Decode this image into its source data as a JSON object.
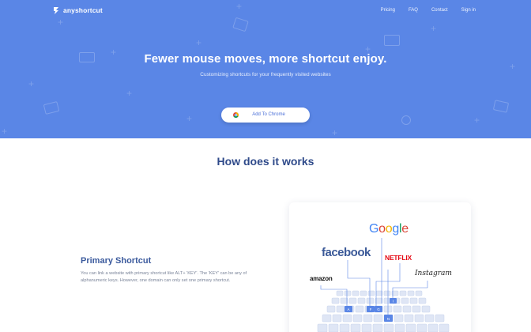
{
  "brand": {
    "name": "anyshortcut",
    "icon": "logo-icon"
  },
  "nav": {
    "items": [
      "Pricing",
      "FAQ",
      "Contact",
      "Sign in"
    ]
  },
  "hero": {
    "title": "Fewer mouse moves, more shortcut enjoy.",
    "subtitle": "Customizing shortcuts for your frequently visited websites",
    "cta_label": "Add To Chrome",
    "cta_icon": "chrome-icon"
  },
  "how": {
    "title": "How does it works",
    "primary": {
      "title": "Primary Shortcut",
      "description": "You can link a website with primary shortcut like ALT+ 'KEY'. The 'KEY' can be any of alphanumeric keys. However, one domain can only set one primary shortcut."
    },
    "illustration": {
      "brands": [
        "Google",
        "facebook",
        "NETFLIX",
        "amazon",
        "Instagram"
      ],
      "keys": [
        "A",
        "F",
        "G",
        "I",
        "N"
      ]
    }
  },
  "colors": {
    "hero_bg": "#5a86e6",
    "heading": "#2f4a8a",
    "accent": "#4a6fd8",
    "facebook": "#3b5998",
    "netflix": "#e50914"
  }
}
